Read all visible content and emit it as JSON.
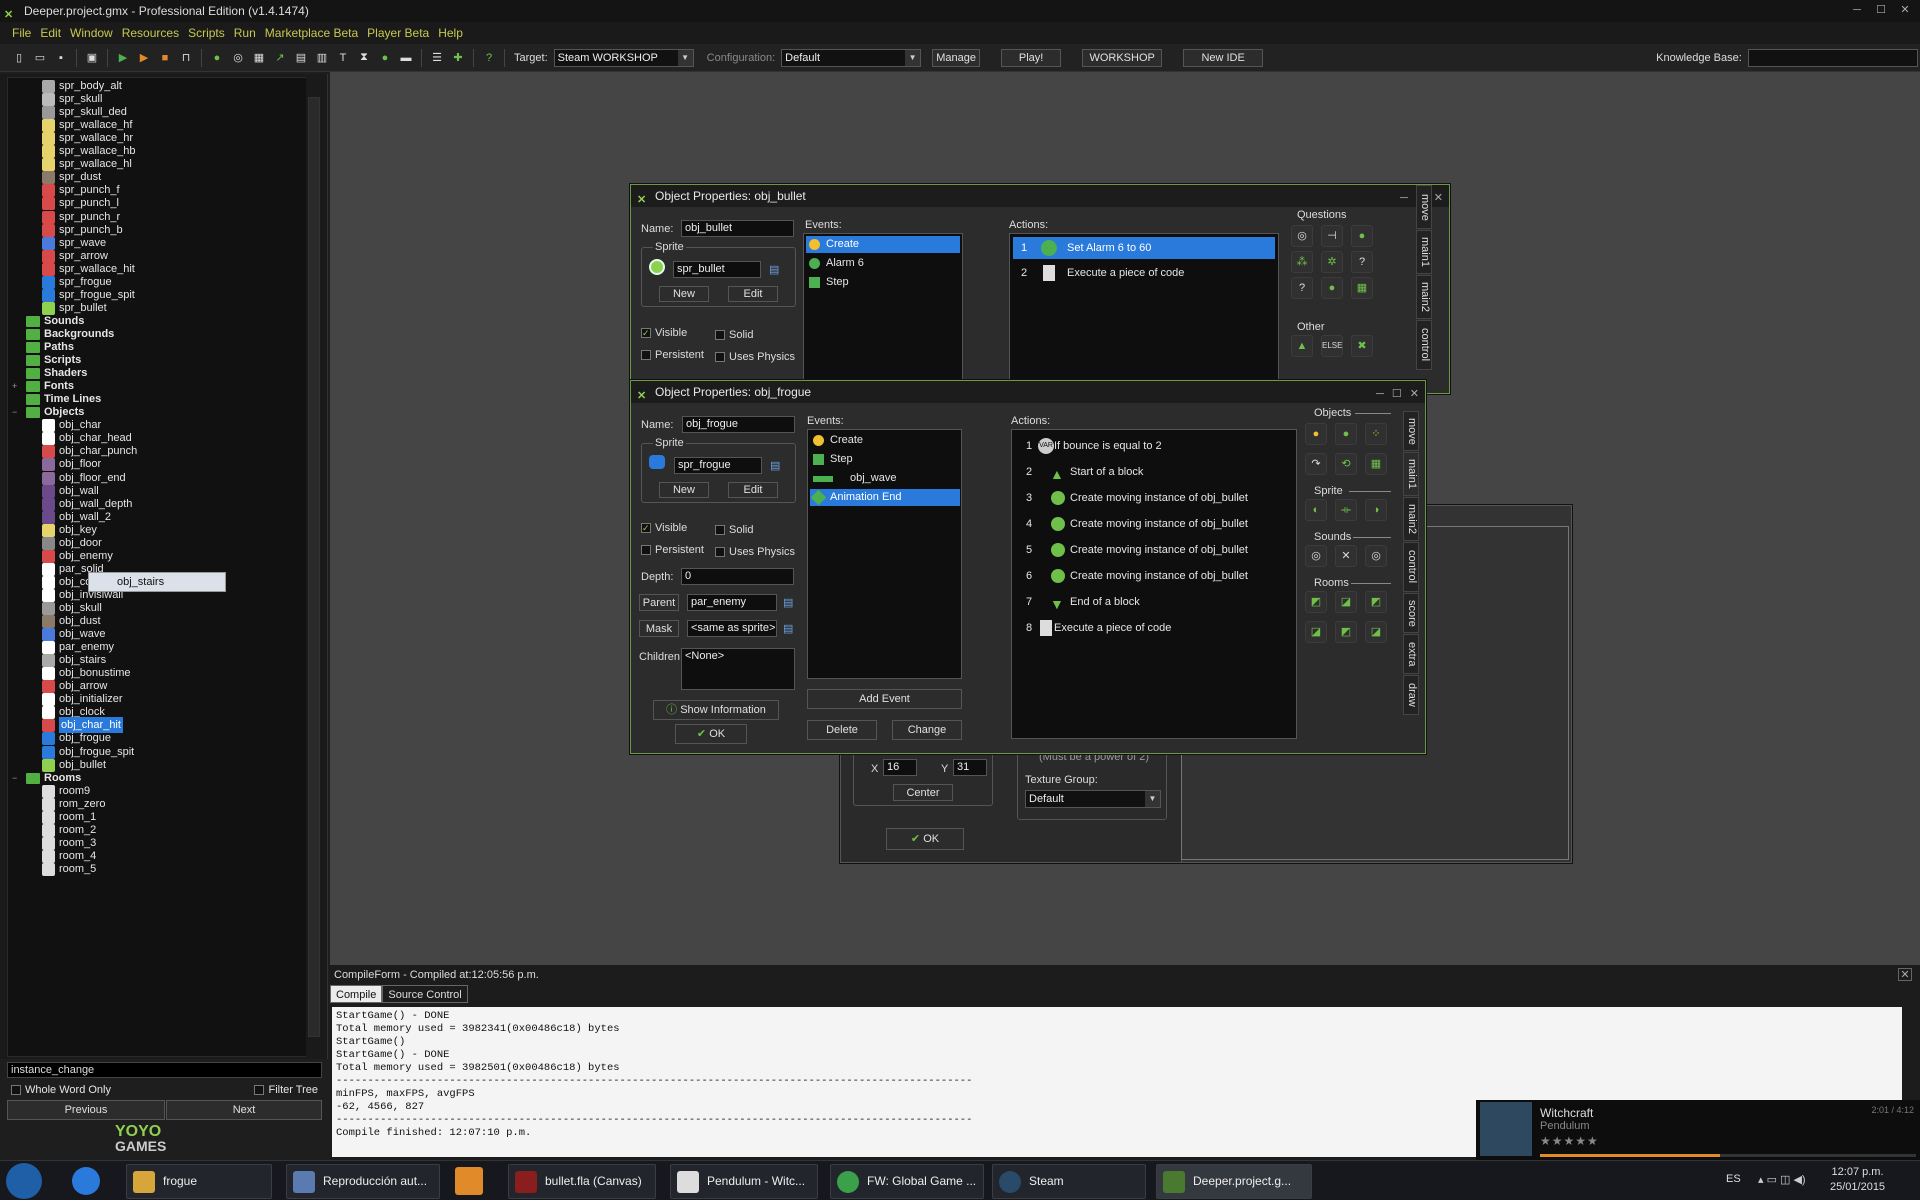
{
  "window": {
    "title": "Deeper.project.gmx - Professional Edition (v1.4.1474)"
  },
  "menu": [
    "File",
    "Edit",
    "Window",
    "Resources",
    "Scripts",
    "Run",
    "Marketplace Beta",
    "Player Beta",
    "Help"
  ],
  "toolbar": {
    "target_label": "Target:",
    "target_value": "Steam WORKSHOP",
    "config_label": "Configuration:",
    "config_value": "Default",
    "manage": "Manage",
    "play": "Play!",
    "workshop": "WORKSHOP",
    "new_ide": "New IDE",
    "kb_label": "Knowledge Base:"
  },
  "tree": {
    "sprites": [
      "spr_body_alt",
      "spr_skull",
      "spr_skull_ded",
      "spr_wallace_hf",
      "spr_wallace_hr",
      "spr_wallace_hb",
      "spr_wallace_hl",
      "spr_dust",
      "spr_punch_f",
      "spr_punch_l",
      "spr_punch_r",
      "spr_punch_b",
      "spr_wave",
      "spr_arrow",
      "spr_wallace_hit",
      "spr_frogue",
      "spr_frogue_spit",
      "spr_bullet"
    ],
    "folders": [
      "Sounds",
      "Backgrounds",
      "Paths",
      "Scripts",
      "Shaders",
      "Fonts",
      "Time Lines",
      "Objects"
    ],
    "objects": [
      "obj_char",
      "obj_char_head",
      "obj_char_punch",
      "obj_floor",
      "obj_floor_end",
      "obj_wall",
      "obj_wall_depth",
      "obj_wall_2",
      "obj_key",
      "obj_door",
      "obj_enemy",
      "par_solid",
      "obj_control",
      "obj_invisiwall",
      "obj_skull",
      "obj_dust",
      "obj_wave",
      "par_enemy",
      "obj_stairs",
      "obj_bonustime",
      "obj_arrow",
      "obj_initializer",
      "obj_clock",
      "obj_char_hit",
      "obj_frogue",
      "obj_frogue_spit",
      "obj_bullet"
    ],
    "rooms_folder": "Rooms",
    "rooms": [
      "room9",
      "rom_zero",
      "room_1",
      "room_2",
      "room_3",
      "room_4",
      "room_5"
    ],
    "drag_item": "obj_stairs",
    "search_value": "instance_change",
    "whole_word": "Whole Word Only",
    "filter_tree": "Filter Tree",
    "previous": "Previous",
    "next": "Next",
    "logo_line1": "YOYO",
    "logo_line2": "GAMES"
  },
  "bullet": {
    "title": "Object Properties: obj_bullet",
    "name_label": "Name:",
    "name": "obj_bullet",
    "sprite_label": "Sprite",
    "sprite": "spr_bullet",
    "new": "New",
    "edit": "Edit",
    "visible": "Visible",
    "solid": "Solid",
    "persistent": "Persistent",
    "physics": "Uses Physics",
    "events_label": "Events:",
    "events": [
      "Create",
      "Alarm 6",
      "Step"
    ],
    "actions_label": "Actions:",
    "actions": [
      {
        "n": "1",
        "text": "Set Alarm 6 to 60"
      },
      {
        "n": "2",
        "text": "Execute a piece of code"
      }
    ],
    "questions": "Questions",
    "other": "Other",
    "tabs": [
      "move",
      "main1",
      "main2",
      "control",
      "score",
      "extra",
      "draw"
    ]
  },
  "frogue": {
    "title": "Object Properties: obj_frogue",
    "name_label": "Name:",
    "name": "obj_frogue",
    "sprite_label": "Sprite",
    "sprite": "spr_frogue",
    "new": "New",
    "edit": "Edit",
    "visible": "Visible",
    "solid": "Solid",
    "persistent": "Persistent",
    "physics": "Uses Physics",
    "depth_label": "Depth:",
    "depth": "0",
    "parent_label": "Parent",
    "parent": "par_enemy",
    "mask_label": "Mask",
    "mask": "<same as sprite>",
    "children_label": "Children:",
    "children": "<None>",
    "show_info": "Show Information",
    "ok": "OK",
    "events_label": "Events:",
    "events": [
      "Create",
      "Step",
      "obj_wave",
      "Animation End"
    ],
    "add_event": "Add Event",
    "delete": "Delete",
    "change": "Change",
    "actions_label": "Actions:",
    "actions": [
      {
        "n": "1",
        "text": "If bounce is equal to 2"
      },
      {
        "n": "2",
        "text": "Start of a block"
      },
      {
        "n": "3",
        "text": "Create moving instance of obj_bullet"
      },
      {
        "n": "4",
        "text": "Create moving instance of obj_bullet"
      },
      {
        "n": "5",
        "text": "Create moving instance of obj_bullet"
      },
      {
        "n": "6",
        "text": "Create moving instance of obj_bullet"
      },
      {
        "n": "7",
        "text": "End of a block"
      },
      {
        "n": "8",
        "text": "Execute a piece of code"
      }
    ],
    "lib_objects": "Objects",
    "lib_sprite": "Sprite",
    "lib_sounds": "Sounds",
    "lib_rooms": "Rooms",
    "tabs": [
      "move",
      "main1",
      "main2",
      "control",
      "score",
      "extra",
      "draw"
    ]
  },
  "sprite_dlg": {
    "x_label": "X",
    "x": "16",
    "y_label": "Y",
    "y": "31",
    "center": "Center",
    "ok": "OK",
    "note": "(Must be a power of 2)",
    "texture_label": "Texture Group:",
    "texture": "Default"
  },
  "compile": {
    "header": "CompileForm - Compiled at:12:05:56 p.m.",
    "tabs": [
      "Compile",
      "Source Control"
    ],
    "log": "StartGame() - DONE\nTotal memory used = 3982341(0x00486c18) bytes\nStartGame()\nStartGame() - DONE\nTotal memory used = 3982501(0x00486c18) bytes\n-----------------------------------------------------------------------------------------------------\nminFPS, maxFPS, avgFPS\n-62, 4566, 827\n-----------------------------------------------------------------------------------------------------\nCompile finished: 12:07:10 p.m."
  },
  "media": {
    "track": "Witchcraft",
    "artist": "Pendulum",
    "time": "2:01 / 4:12"
  },
  "taskbar": {
    "items": [
      "frogue",
      "Reproducción aut...",
      "bullet.fla (Canvas)",
      "Pendulum - Witc...",
      "FW: Global Game ...",
      "Steam",
      "Deeper.project.g..."
    ],
    "lang": "ES",
    "time": "12:07 p.m.",
    "date": "25/01/2015"
  }
}
